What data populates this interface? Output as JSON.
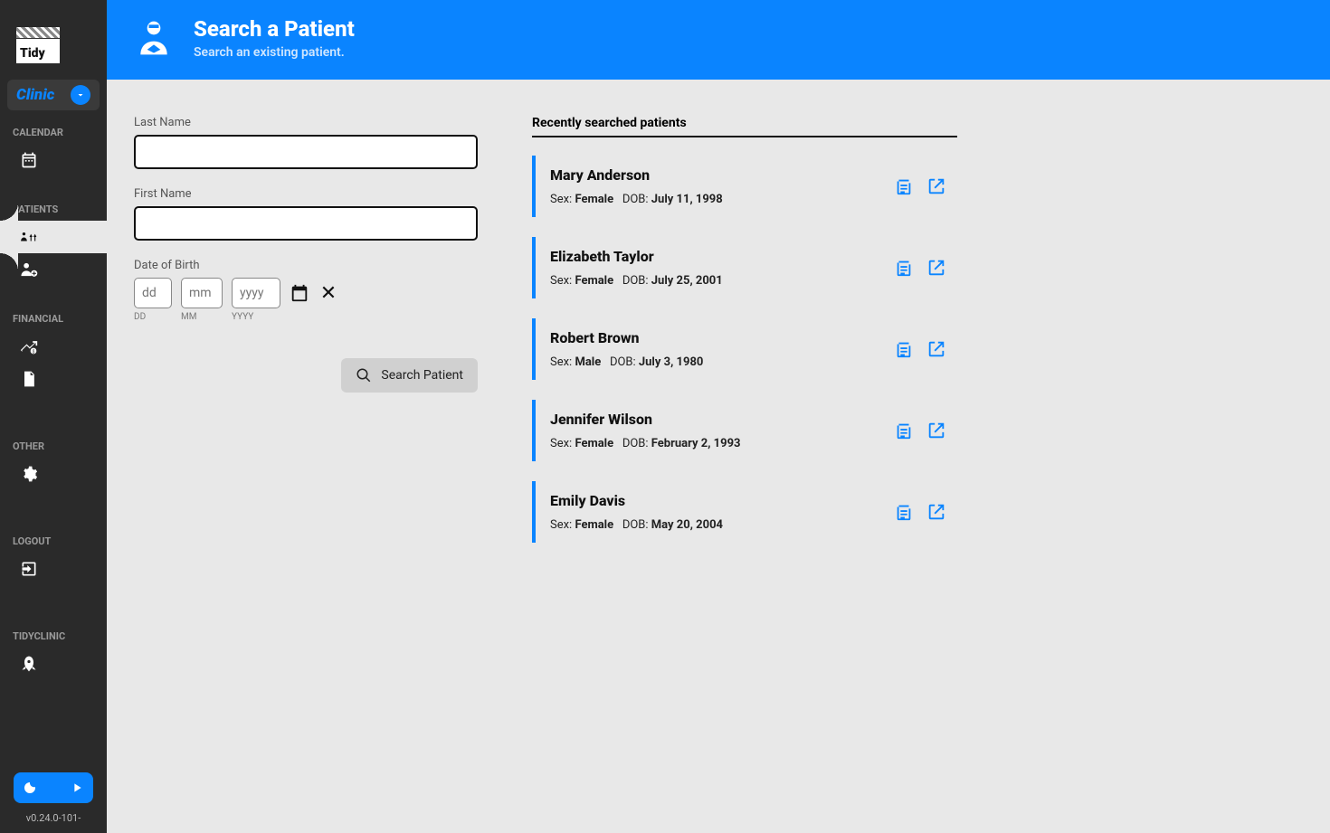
{
  "logo_text": "Tidy",
  "clinic_label": "Clinic",
  "sidebar": {
    "sections": {
      "calendar": "CALENDAR",
      "patients": "PATIENTS",
      "financial": "FINANCIAL",
      "other": "OTHER",
      "logout": "LOGOUT",
      "tidyclinic": "TIDYCLINIC"
    }
  },
  "version": "v0.24.0-101-",
  "header": {
    "title": "Search a Patient",
    "subtitle": "Search an existing patient."
  },
  "form": {
    "last_name_label": "Last Name",
    "first_name_label": "First Name",
    "dob_label": "Date of Birth",
    "dd_placeholder": "dd",
    "mm_placeholder": "mm",
    "yyyy_placeholder": "yyyy",
    "dd_sub": "DD",
    "mm_sub": "MM",
    "yyyy_sub": "YYYY",
    "search_button": "Search Patient"
  },
  "results": {
    "header": "Recently searched patients",
    "sex_label": "Sex:",
    "dob_label": "DOB:",
    "patients": [
      {
        "name": "Mary Anderson",
        "sex": "Female",
        "dob": "July 11, 1998"
      },
      {
        "name": "Elizabeth Taylor",
        "sex": "Female",
        "dob": "July 25, 2001"
      },
      {
        "name": "Robert Brown",
        "sex": "Male",
        "dob": "July 3, 1980"
      },
      {
        "name": "Jennifer Wilson",
        "sex": "Female",
        "dob": "February 2, 1993"
      },
      {
        "name": "Emily Davis",
        "sex": "Female",
        "dob": "May 20, 2004"
      }
    ]
  }
}
